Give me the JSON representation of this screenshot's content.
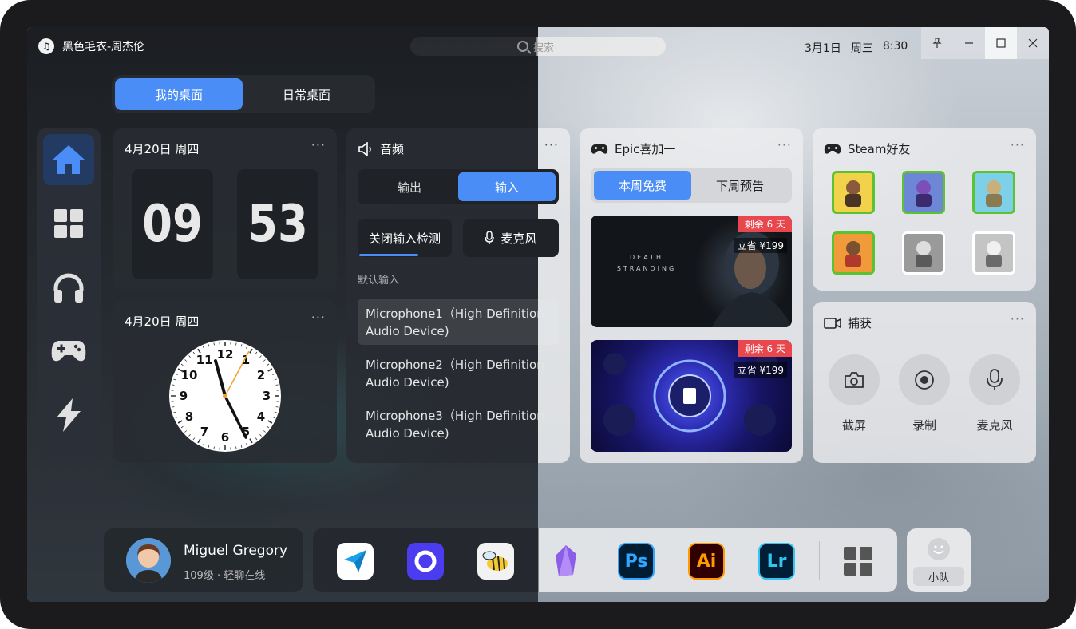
{
  "titlebar": {
    "now_playing": "黑色毛衣-周杰伦",
    "search_placeholder": "搜索",
    "date": "3月1日",
    "weekday": "周三",
    "time": "8:30"
  },
  "desk_tabs": [
    {
      "label": "我的桌面",
      "active": true
    },
    {
      "label": "日常桌面",
      "active": false
    }
  ],
  "sidebar": {
    "items": [
      {
        "icon": "home-icon",
        "active": true
      },
      {
        "icon": "grid-icon",
        "active": false
      },
      {
        "icon": "headphones-icon",
        "active": false
      },
      {
        "icon": "gamepad-icon",
        "active": false
      },
      {
        "icon": "lightning-icon",
        "active": false
      }
    ]
  },
  "digital_clock": {
    "date": "4月20日 周四",
    "hour": "09",
    "minute": "53"
  },
  "analog_clock": {
    "date": "4月20日 周四",
    "numbers": [
      "12",
      "1",
      "2",
      "3",
      "4",
      "5",
      "6",
      "7",
      "8",
      "9",
      "10",
      "11"
    ]
  },
  "audio": {
    "title": "音频",
    "tabs": [
      {
        "label": "输出",
        "active": false
      },
      {
        "label": "输入",
        "active": true
      }
    ],
    "detect_button": "关闭输入检测",
    "mic_button": "麦克风",
    "default_label": "默认输入",
    "devices": [
      {
        "line1": "Microphone1（High Definition",
        "line2": "Audio Device)",
        "selected": true
      },
      {
        "line1": "Microphone2（High Definition",
        "line2": "Audio Device)",
        "selected": false
      },
      {
        "line1": "Microphone3（High Definition",
        "line2": "Audio Device)",
        "selected": false
      }
    ]
  },
  "epic": {
    "title": "Epic喜加一",
    "tabs": [
      {
        "label": "本周免费",
        "active": true
      },
      {
        "label": "下周预告",
        "active": false
      }
    ],
    "games": [
      {
        "tag": "剩余 6 天",
        "save": "立省 ¥199",
        "art_text": "DEATH STRANDING"
      },
      {
        "tag": "剩余 6 天",
        "save": "立省 ¥199",
        "art_text": ""
      }
    ]
  },
  "steam": {
    "title": "Steam好友"
  },
  "capture": {
    "title": "捕获",
    "actions": [
      {
        "label": "截屏",
        "icon": "camera-icon"
      },
      {
        "label": "录制",
        "icon": "record-icon"
      },
      {
        "label": "麦克风",
        "icon": "microphone-icon"
      }
    ]
  },
  "user": {
    "name": "Miguel Gregory",
    "status": "109级 · 轻聊在线"
  },
  "dock": {
    "apps": [
      {
        "name": "paper-plane-app-icon",
        "text": ""
      },
      {
        "name": "circle-app-icon",
        "text": ""
      },
      {
        "name": "bee-app-icon",
        "text": ""
      },
      {
        "name": "crystal-app-icon",
        "text": ""
      },
      {
        "name": "photoshop-icon",
        "text": "Ps"
      },
      {
        "name": "illustrator-icon",
        "text": "Ai"
      },
      {
        "name": "lightroom-icon",
        "text": "Lr"
      }
    ]
  },
  "team": {
    "label": "小队"
  }
}
